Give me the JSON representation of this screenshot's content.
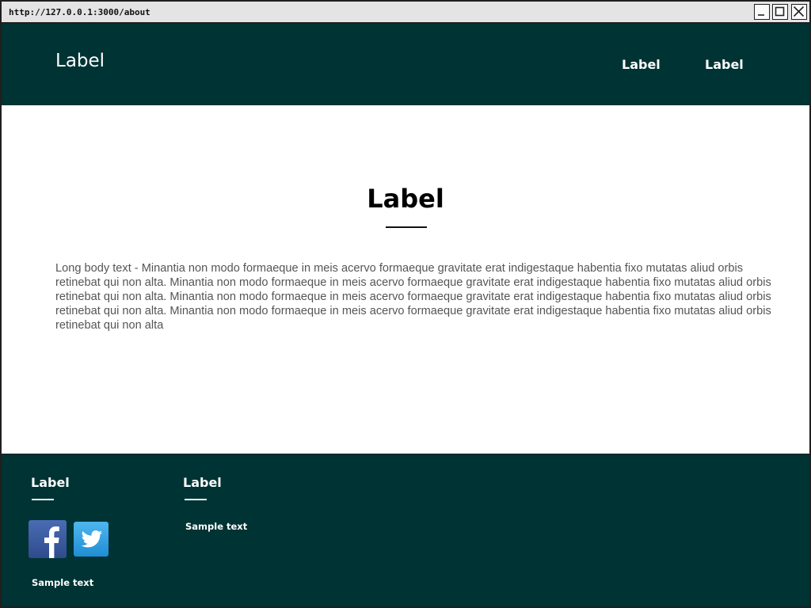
{
  "browser": {
    "url": "http://127.0.0.1:3000/about"
  },
  "header": {
    "brand": "Label",
    "nav": [
      {
        "label": "Label"
      },
      {
        "label": "Label"
      }
    ],
    "background_color": "#003333"
  },
  "main": {
    "title": "Label",
    "body": "Long body text - Minantia non modo formaeque in meis acervo formaeque gravitate erat indigestaque habentia fixo mutatas aliud orbis retinebat qui non alta. Minantia non modo formaeque in meis acervo formaeque gravitate erat indigestaque habentia fixo mutatas aliud orbis retinebat qui non alta. Minantia non modo formaeque in meis acervo formaeque gravitate erat indigestaque habentia fixo mutatas aliud orbis retinebat qui non alta. Minantia non modo formaeque in meis acervo formaeque gravitate erat indigestaque habentia fixo mutatas aliud orbis retinebat qui non alta"
  },
  "footer": {
    "columns": [
      {
        "heading": "Label",
        "social": [
          {
            "icon": "facebook-icon",
            "color": "#3b5998"
          },
          {
            "icon": "twitter-icon",
            "color": "#2ea3e6"
          }
        ],
        "text": "Sample text"
      },
      {
        "heading": "Label",
        "text": "Sample text"
      }
    ],
    "background_color": "#003333"
  },
  "window_controls": [
    {
      "icon": "minimize-icon"
    },
    {
      "icon": "maximize-icon"
    },
    {
      "icon": "close-icon"
    }
  ]
}
